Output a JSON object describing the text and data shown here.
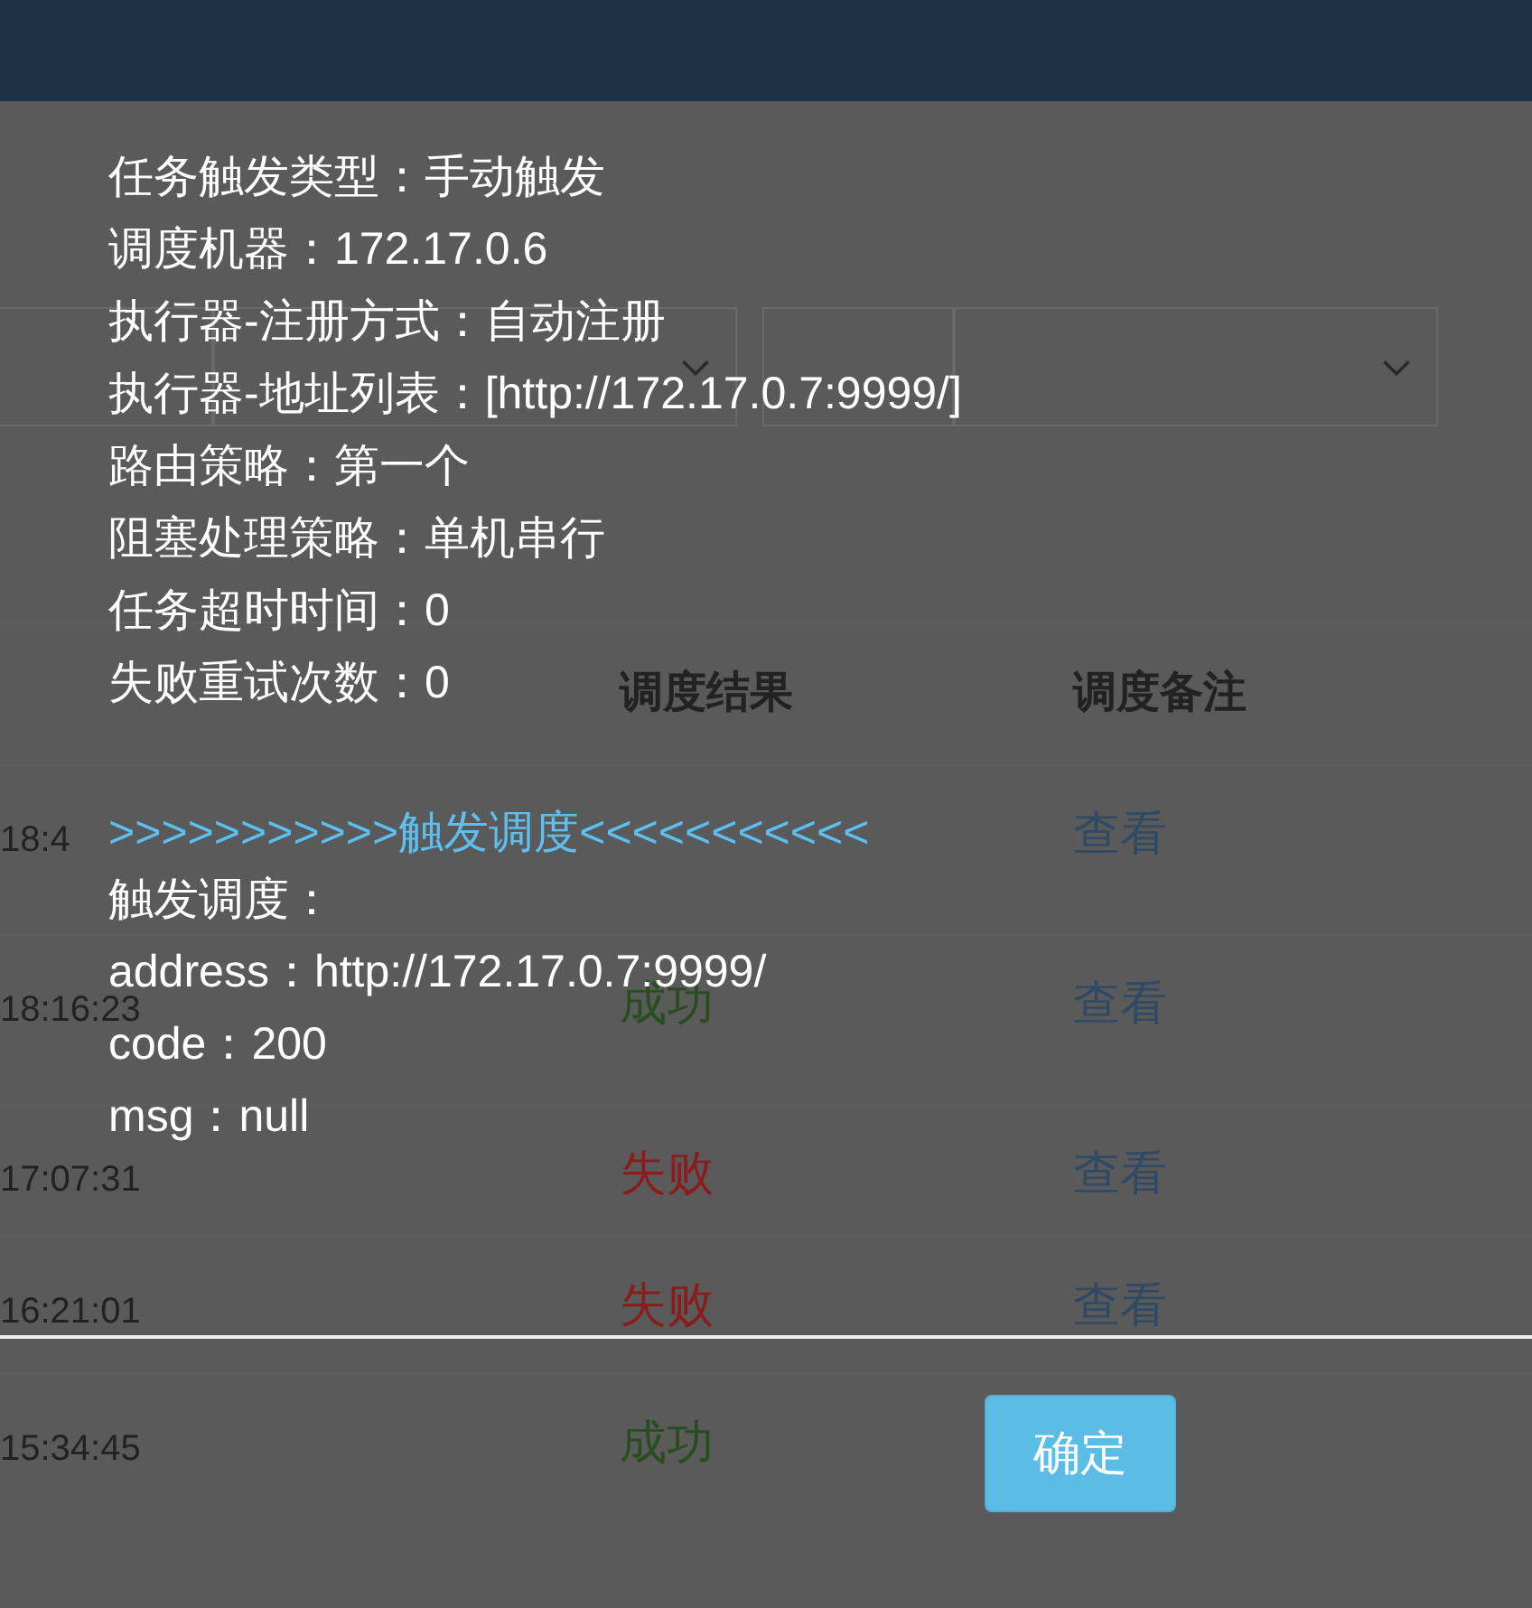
{
  "table": {
    "columns": [
      "调度结果",
      "调度备注"
    ],
    "rows": [
      {
        "time": "18:4",
        "remark": "查看"
      },
      {
        "time": "18:16:23",
        "result": "成功",
        "color": "#284d1f",
        "remark": "查看"
      },
      {
        "time": "17:07:31",
        "result": "失败",
        "color": "#8a1c1c",
        "remark": "查看"
      },
      {
        "time": "16:21:01",
        "result": "失败",
        "color": "#8a1c1c",
        "remark": "查看"
      },
      {
        "time": "15:34:45",
        "result": "成功",
        "color": "#284d1f"
      }
    ]
  },
  "dialog": {
    "lines": [
      {
        "kind": "text",
        "text": "任务触发类型：手动触发"
      },
      {
        "kind": "text",
        "text": "调度机器：172.17.0.6"
      },
      {
        "kind": "text",
        "text": "执行器-注册方式：自动注册"
      },
      {
        "kind": "text",
        "text": "执行器-地址列表：[http://172.17.0.7:9999/]"
      },
      {
        "kind": "text",
        "text": "路由策略：第一个"
      },
      {
        "kind": "text",
        "text": "阻塞处理策略：单机串行"
      },
      {
        "kind": "text",
        "text": "任务超时时间：0"
      },
      {
        "kind": "text",
        "text": "失败重试次数：0"
      },
      {
        "kind": "highlight",
        "text": ">>>>>>>>>>>触发调度<<<<<<<<<<<"
      },
      {
        "kind": "text",
        "text": "触发调度："
      },
      {
        "kind": "text",
        "text": "address：http://172.17.0.7:9999/"
      },
      {
        "kind": "text",
        "text": "code：200"
      },
      {
        "kind": "text",
        "text": "msg：null"
      }
    ],
    "button": "确定"
  }
}
